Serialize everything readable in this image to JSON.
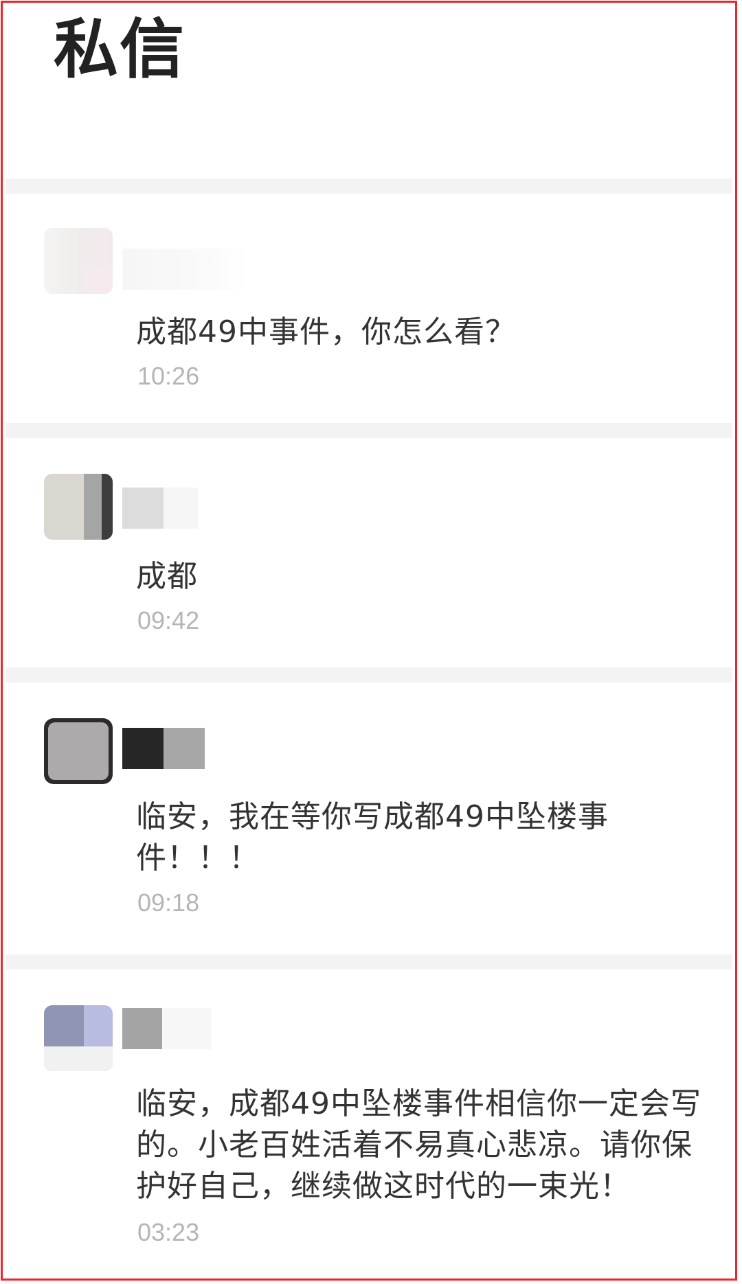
{
  "header": {
    "title": "私信"
  },
  "messages": [
    {
      "text": "成都49中事件，你怎么看？",
      "time": "10:26"
    },
    {
      "text": "成都",
      "time": "09:42"
    },
    {
      "text": "临安，我在等你写成都49中坠楼事件！！！",
      "time": "09:18"
    },
    {
      "text": "临安，成都49中坠楼事件相信你一定会写的。小老百姓活着不易真心悲凉。请你保护好自己，继续做这时代的一束光！",
      "time": "03:23"
    }
  ],
  "colors": {
    "border": "#e8262b",
    "divider": "#f3f3f3",
    "text": "#333333",
    "time": "#b5b5b5"
  }
}
